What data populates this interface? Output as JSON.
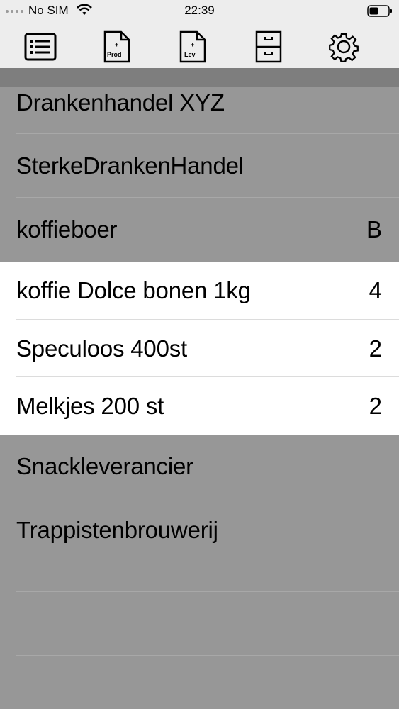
{
  "status": {
    "carrier": "No SIM",
    "time": "22:39"
  },
  "toolbar": {
    "prod_label": "Prod",
    "lev_label": "Lev",
    "plus": "+"
  },
  "suppliers_top": [
    {
      "name": "Drankenhandel XYZ",
      "value": ""
    },
    {
      "name": "SterkeDrankenHandel",
      "value": ""
    },
    {
      "name": "koffieboer",
      "value": "B"
    }
  ],
  "items": [
    {
      "name": "koffie Dolce bonen 1kg",
      "qty": "4"
    },
    {
      "name": "Speculoos 400st",
      "qty": "2"
    },
    {
      "name": "Melkjes 200 st",
      "qty": "2"
    }
  ],
  "suppliers_bottom": [
    {
      "name": "Snackleverancier"
    },
    {
      "name": "Trappistenbrouwerij"
    }
  ]
}
